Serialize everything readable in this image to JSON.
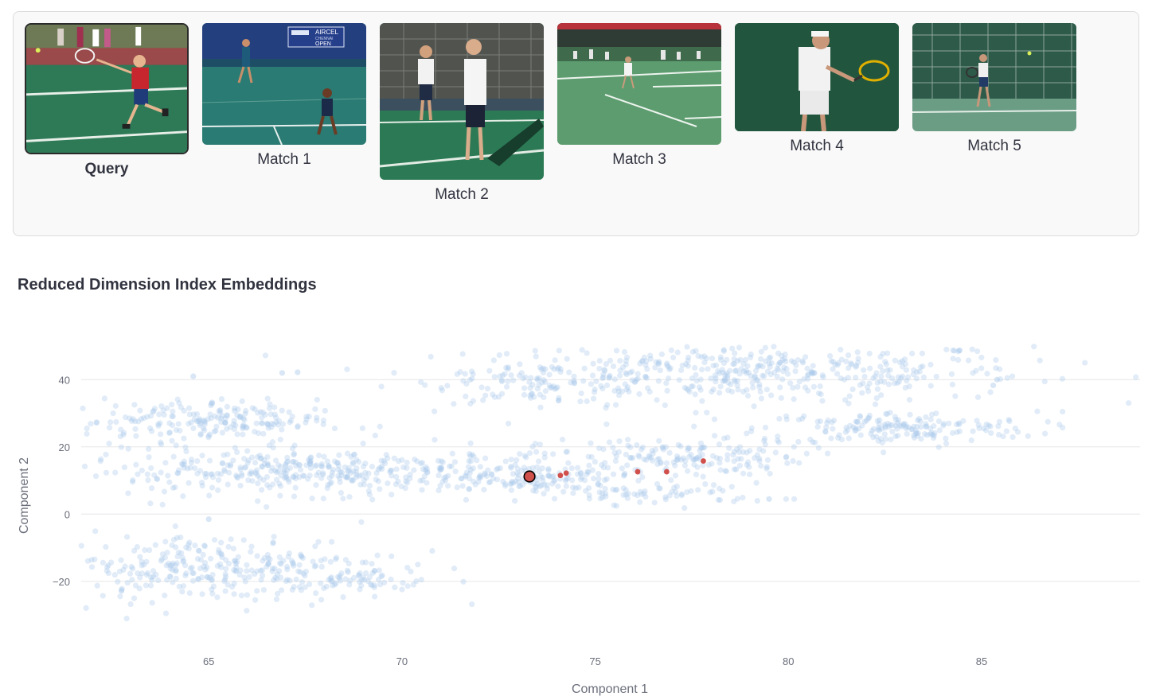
{
  "gallery": {
    "query": {
      "caption": "Query",
      "image": "photo: boy in red shirt hitting tennis ball on green court"
    },
    "matches": [
      {
        "caption": "Match 1",
        "image": "photo: two tennis players on blue-green court at Aircel Chennai Open"
      },
      {
        "caption": "Match 2",
        "image": "photo: two young players holding rackets on green court"
      },
      {
        "caption": "Match 3",
        "image": "photo: player serving on green court with spectators"
      },
      {
        "caption": "Match 4",
        "image": "photo: man in white hitting backhand"
      },
      {
        "caption": "Match 5",
        "image": "photo: woman playing tennis in front of green fence"
      }
    ],
    "banner_text": {
      "line1": "AIRCEL",
      "line2": "CHENNAI",
      "line3": "OPEN"
    }
  },
  "section": {
    "title": "Reduced Dimension Index Embeddings"
  },
  "chart_data": {
    "type": "scatter",
    "title": "Reduced Dimension Index Embeddings",
    "xlabel": "Component 1",
    "ylabel": "Component 2",
    "xlim": [
      61.7,
      89.1
    ],
    "ylim": [
      -34,
      50
    ],
    "xticks": [
      65,
      70,
      75,
      80,
      85
    ],
    "yticks": [
      -20,
      0,
      20,
      40
    ],
    "ytick_labels": [
      "−20",
      "0",
      "20",
      "40"
    ],
    "grid": true,
    "colors": {
      "index": "#a9c8ec",
      "matches": "#d0504c",
      "query": "#d0504c",
      "query_outline": "#000000"
    },
    "index_clusters": [
      {
        "cx": 79.0,
        "cy": 42.0,
        "sx": 3.6,
        "sy": 4.5,
        "n": 460
      },
      {
        "cx": 73.5,
        "cy": 39.0,
        "sx": 1.3,
        "sy": 3.0,
        "n": 80
      },
      {
        "cx": 82.8,
        "cy": 25.5,
        "sx": 1.8,
        "sy": 2.5,
        "n": 180
      },
      {
        "cx": 77.0,
        "cy": 17.0,
        "sx": 1.7,
        "sy": 2.7,
        "n": 160
      },
      {
        "cx": 76.5,
        "cy": 6.0,
        "sx": 1.6,
        "sy": 1.6,
        "n": 70
      },
      {
        "cx": 68.0,
        "cy": 12.5,
        "sx": 3.3,
        "sy": 3.3,
        "n": 420
      },
      {
        "cx": 73.3,
        "cy": 11.0,
        "sx": 1.3,
        "sy": 1.8,
        "n": 110
      },
      {
        "cx": 64.0,
        "cy": 27.0,
        "sx": 1.9,
        "sy": 3.5,
        "n": 170
      },
      {
        "cx": 66.2,
        "cy": 28.5,
        "sx": 0.9,
        "sy": 2.0,
        "n": 50
      },
      {
        "cx": 65.3,
        "cy": -16.0,
        "sx": 2.3,
        "sy": 5.0,
        "n": 320
      },
      {
        "cx": 69.0,
        "cy": -20.0,
        "sx": 0.8,
        "sy": 1.6,
        "n": 40
      }
    ],
    "index_outliers": [
      {
        "x": 65.0,
        "y": -1.5
      },
      {
        "x": 66.9,
        "y": 42
      },
      {
        "x": 67.3,
        "y": 42.2
      },
      {
        "x": 64.6,
        "y": 41
      },
      {
        "x": 79.5,
        "y": 4.5
      },
      {
        "x": 85.3,
        "y": 38.3
      },
      {
        "x": 85.4,
        "y": 40
      }
    ],
    "matches": [
      {
        "name": "Match 1",
        "x": 74.1,
        "y": 11.5
      },
      {
        "name": "Match 2",
        "x": 74.25,
        "y": 12.2
      },
      {
        "name": "Match 3",
        "x": 76.1,
        "y": 12.6
      },
      {
        "name": "Match 4",
        "x": 76.85,
        "y": 12.6
      },
      {
        "name": "Match 5",
        "x": 77.8,
        "y": 15.8
      }
    ],
    "query": {
      "name": "Query",
      "x": 73.3,
      "y": 11.2
    }
  }
}
